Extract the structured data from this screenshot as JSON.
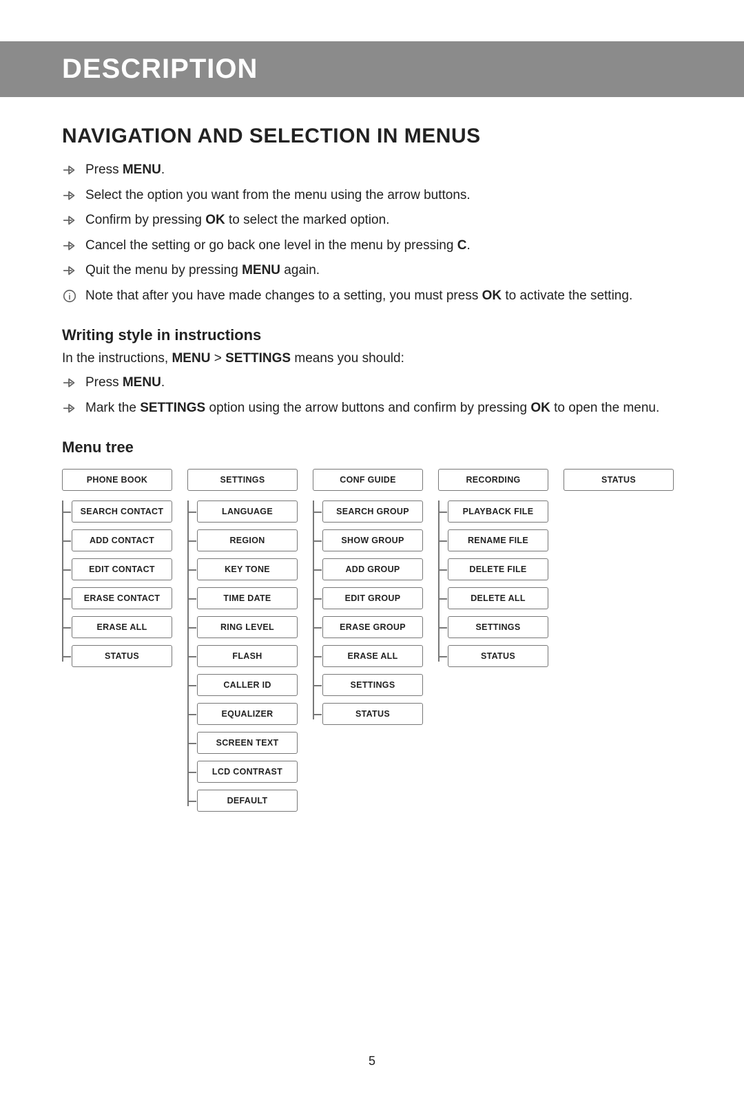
{
  "banner": "DESCRIPTION",
  "section_title": "NAVIGATION AND SELECTION IN MENUS",
  "steps1": [
    {
      "icon": "arrow",
      "pre": "Press ",
      "bold": "MENU",
      "post": "."
    },
    {
      "icon": "arrow",
      "pre": "Select the option you want from the menu using the arrow buttons.",
      "bold": "",
      "post": ""
    },
    {
      "icon": "arrow",
      "pre": "Confirm by pressing ",
      "bold": "OK",
      "post": " to select the marked option."
    },
    {
      "icon": "arrow",
      "pre": "Cancel the setting or go back one level in the menu by pressing ",
      "bold": "C",
      "post": "."
    },
    {
      "icon": "arrow",
      "pre": "Quit the menu by pressing ",
      "bold": "MENU",
      "post": " again."
    },
    {
      "icon": "info",
      "pre": "Note that after you have made changes to a setting, you must press ",
      "bold": "OK",
      "post": " to activate the setting."
    }
  ],
  "sub1_title": "Writing style in instructions",
  "sub1_intro_pre": "In the instructions, ",
  "sub1_intro_bold1": "MENU",
  "sub1_intro_mid": " > ",
  "sub1_intro_bold2": "SETTINGS",
  "sub1_intro_post": " means you should:",
  "steps2": [
    {
      "icon": "arrow",
      "pre": "Press ",
      "bold": "MENU",
      "post": "."
    },
    {
      "icon": "arrow",
      "pre": "Mark the ",
      "bold": "SETTINGS",
      "post": " option using the arrow buttons and confirm by pressing ",
      "bold2": "OK",
      "post2": " to open the menu."
    }
  ],
  "sub2_title": "Menu tree",
  "tree": [
    {
      "root": "PHONE BOOK",
      "children": [
        "SEARCH CONTACT",
        "ADD CONTACT",
        "EDIT CONTACT",
        "ERASE CONTACT",
        "ERASE ALL",
        "STATUS"
      ]
    },
    {
      "root": "SETTINGS",
      "children": [
        "LANGUAGE",
        "REGION",
        "KEY TONE",
        "TIME DATE",
        "RING LEVEL",
        "FLASH",
        "CALLER ID",
        "EQUALIZER",
        "SCREEN TEXT",
        "LCD CONTRAST",
        "DEFAULT"
      ]
    },
    {
      "root": "CONF GUIDE",
      "children": [
        "SEARCH GROUP",
        "SHOW GROUP",
        "ADD GROUP",
        "EDIT GROUP",
        "ERASE GROUP",
        "ERASE ALL",
        "SETTINGS",
        "STATUS"
      ]
    },
    {
      "root": "RECORDING",
      "children": [
        "PLAYBACK FILE",
        "RENAME FILE",
        "DELETE FILE",
        "DELETE ALL",
        "SETTINGS",
        "STATUS"
      ]
    },
    {
      "root": "STATUS",
      "children": []
    }
  ],
  "page_number": "5"
}
